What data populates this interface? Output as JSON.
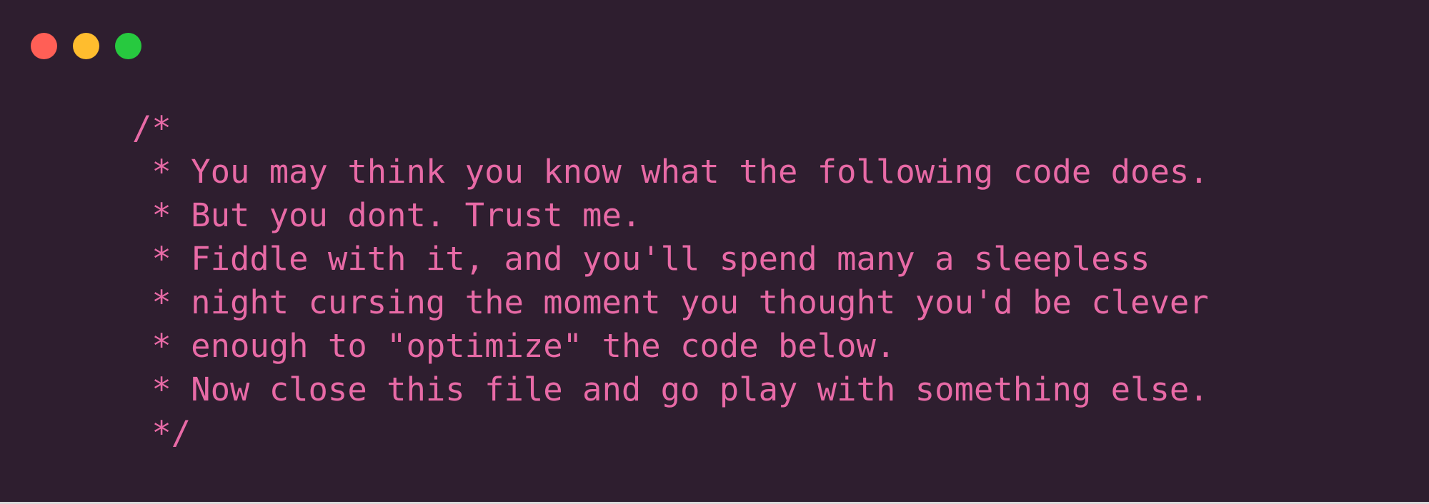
{
  "window": {
    "background_color": "#2e1e2f",
    "controls": [
      {
        "name": "close",
        "color": "#ff5f56"
      },
      {
        "name": "minimize",
        "color": "#ffbd2e"
      },
      {
        "name": "zoom",
        "color": "#27c93f"
      }
    ]
  },
  "code": {
    "text_color": "#e86aa6",
    "lines": [
      "/*",
      " * You may think you know what the following code does.",
      " * But you dont. Trust me.",
      " * Fiddle with it, and you'll spend many a sleepless",
      " * night cursing the moment you thought you'd be clever",
      " * enough to \"optimize\" the code below.",
      " * Now close this file and go play with something else.",
      " */"
    ]
  }
}
